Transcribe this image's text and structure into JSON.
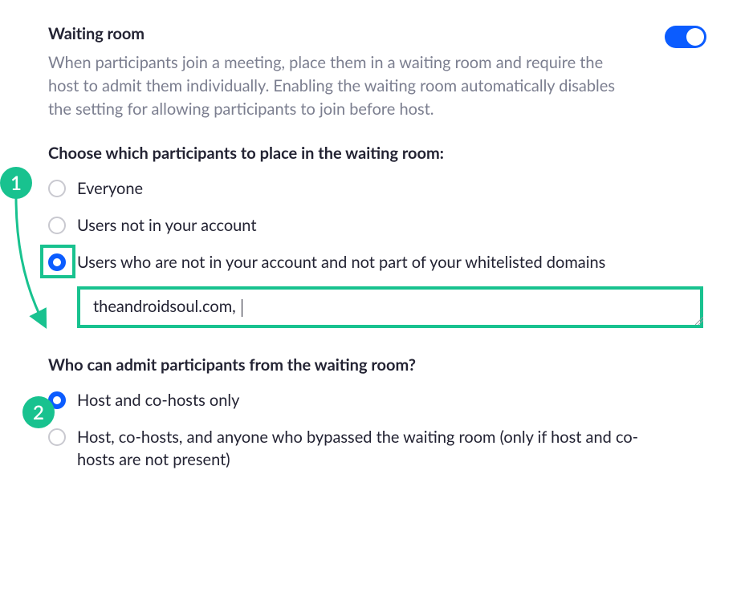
{
  "annotations": {
    "badge1": "1",
    "badge2": "2"
  },
  "waitingRoom": {
    "title": "Waiting room",
    "description": "When participants join a meeting, place them in a waiting room and require the host to admit them individually. Enabling the waiting room automatically disables the setting for allowing participants to join before host.",
    "enabled": true
  },
  "placement": {
    "heading": "Choose which participants to place in the waiting room:",
    "options": {
      "everyone": "Everyone",
      "notInAccount": "Users not in your account",
      "notInAccountOrWhitelist": "Users who are not in your account and not part of your whitelisted domains"
    },
    "selected": "notInAccountOrWhitelist",
    "domainsInputValue": "theandroidsoul.com, "
  },
  "admit": {
    "heading": "Who can admit participants from the waiting room?",
    "options": {
      "hostOnly": "Host and co-hosts only",
      "hostAndBypassed": "Host, co-hosts, and anyone who bypassed the waiting room (only if host and co-hosts are not present)"
    },
    "selected": "hostOnly"
  }
}
